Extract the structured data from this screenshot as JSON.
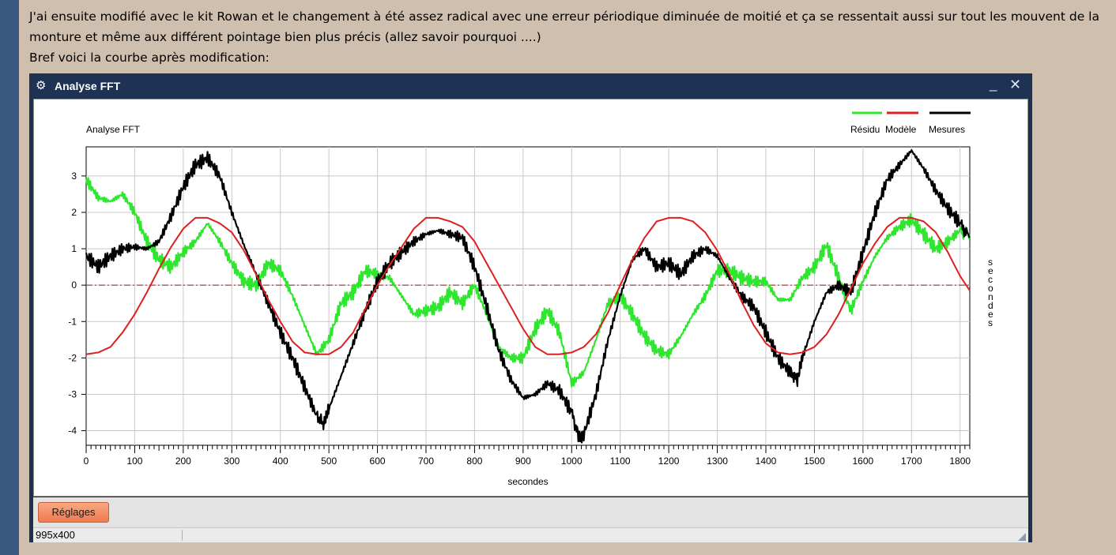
{
  "post": {
    "line1": "J'ai ensuite modifié avec le kit Rowan et le changement à été assez radical avec une erreur périodique diminuée de moitié et ça se ressentait aussi sur tout les mouvent de la",
    "line2": "monture et même aux différent pointage bien plus précis (allez savoir pourquoi ....)",
    "line3": "Bref voici la courbe après modification:"
  },
  "window": {
    "title": "Analyse FFT",
    "icon": "gear-icon",
    "minimize": "_",
    "close": "✕",
    "reglages_label": "Réglages",
    "status_text": "995x400",
    "colors": {
      "titlebar": "#1e3254",
      "button": "#f07a4e"
    }
  },
  "chart_data": {
    "type": "line",
    "title": "Analyse FFT",
    "xlabel": "secondes",
    "ylabel": "secondes",
    "xlim": [
      0,
      1820
    ],
    "ylim": [
      -4.4,
      3.8
    ],
    "xticks": [
      0,
      100,
      200,
      300,
      400,
      500,
      600,
      700,
      800,
      900,
      1000,
      1100,
      1200,
      1300,
      1400,
      1500,
      1600,
      1700,
      1800
    ],
    "yticks": [
      -4,
      -3,
      -2,
      -1,
      0,
      1,
      2,
      3
    ],
    "grid": true,
    "legend_position": "top-right",
    "series": [
      {
        "name": "Modèle",
        "color": "#dd1f1f",
        "x": [
          0,
          25,
          50,
          75,
          100,
          125,
          150,
          175,
          200,
          225,
          250,
          275,
          300,
          325,
          350,
          375,
          400,
          425,
          450,
          475,
          500,
          525,
          550,
          575,
          600,
          625,
          650,
          675,
          700,
          725,
          750,
          775,
          800,
          825,
          850,
          875,
          900,
          925,
          950,
          975,
          1000,
          1025,
          1050,
          1075,
          1100,
          1125,
          1150,
          1175,
          1200,
          1225,
          1250,
          1275,
          1300,
          1325,
          1350,
          1375,
          1400,
          1425,
          1450,
          1475,
          1500,
          1525,
          1550,
          1575,
          1600,
          1625,
          1650,
          1675,
          1700,
          1725,
          1750,
          1775,
          1800,
          1820
        ],
        "y": [
          -1.9,
          -1.85,
          -1.7,
          -1.3,
          -0.8,
          -0.2,
          0.45,
          1.05,
          1.55,
          1.85,
          1.85,
          1.7,
          1.45,
          0.95,
          0.3,
          -0.4,
          -1.0,
          -1.55,
          -1.85,
          -1.9,
          -1.9,
          -1.7,
          -1.3,
          -0.65,
          0.0,
          0.55,
          1.05,
          1.55,
          1.85,
          1.85,
          1.75,
          1.6,
          1.2,
          0.6,
          0.0,
          -0.6,
          -1.2,
          -1.7,
          -1.9,
          -1.9,
          -1.85,
          -1.7,
          -1.35,
          -0.75,
          0.0,
          0.7,
          1.3,
          1.75,
          1.85,
          1.85,
          1.75,
          1.45,
          0.95,
          0.3,
          -0.45,
          -1.1,
          -1.6,
          -1.85,
          -1.9,
          -1.85,
          -1.7,
          -1.35,
          -0.8,
          -0.1,
          0.6,
          1.15,
          1.6,
          1.85,
          1.85,
          1.75,
          1.45,
          0.9,
          0.25,
          -0.15
        ]
      },
      {
        "name": "Mesures",
        "color": "#000000",
        "x": [
          0,
          25,
          50,
          75,
          100,
          125,
          150,
          175,
          200,
          225,
          250,
          275,
          300,
          325,
          350,
          375,
          400,
          425,
          450,
          475,
          490,
          500,
          525,
          550,
          575,
          600,
          625,
          650,
          675,
          700,
          725,
          750,
          775,
          800,
          825,
          850,
          875,
          900,
          925,
          950,
          975,
          1000,
          1015,
          1025,
          1050,
          1075,
          1100,
          1125,
          1150,
          1175,
          1200,
          1225,
          1250,
          1275,
          1300,
          1325,
          1350,
          1375,
          1400,
          1425,
          1450,
          1465,
          1475,
          1500,
          1525,
          1550,
          1575,
          1600,
          1625,
          1650,
          1675,
          1700,
          1725,
          1750,
          1775,
          1800,
          1820
        ],
        "y": [
          0.8,
          0.5,
          0.8,
          1.0,
          1.05,
          1.0,
          1.2,
          1.9,
          2.7,
          3.3,
          3.5,
          3.0,
          2.0,
          1.1,
          0.3,
          -0.5,
          -1.3,
          -2.0,
          -2.8,
          -3.6,
          -3.8,
          -3.4,
          -2.5,
          -1.6,
          -0.7,
          0.1,
          0.6,
          0.9,
          1.2,
          1.4,
          1.5,
          1.4,
          1.3,
          0.5,
          -0.6,
          -1.8,
          -2.6,
          -3.1,
          -3.0,
          -2.7,
          -2.9,
          -3.5,
          -4.2,
          -4.1,
          -3.0,
          -1.5,
          -0.3,
          0.7,
          1.0,
          0.5,
          0.6,
          0.3,
          0.8,
          1.0,
          0.8,
          0.2,
          -0.3,
          -0.6,
          -1.3,
          -2.0,
          -2.4,
          -2.6,
          -2.0,
          -1.0,
          -0.2,
          0.0,
          -0.2,
          0.9,
          2.0,
          2.9,
          3.3,
          3.7,
          3.2,
          2.6,
          2.1,
          1.7,
          1.3
        ]
      },
      {
        "name": "Résidu",
        "color": "#2ee62e",
        "x": [
          0,
          25,
          50,
          75,
          100,
          125,
          150,
          175,
          200,
          225,
          250,
          275,
          300,
          325,
          350,
          375,
          400,
          425,
          450,
          475,
          500,
          525,
          550,
          575,
          600,
          625,
          650,
          675,
          700,
          725,
          750,
          775,
          800,
          825,
          850,
          875,
          900,
          925,
          950,
          975,
          1000,
          1025,
          1050,
          1075,
          1100,
          1125,
          1150,
          1175,
          1200,
          1225,
          1250,
          1275,
          1300,
          1325,
          1350,
          1375,
          1400,
          1425,
          1450,
          1475,
          1500,
          1525,
          1550,
          1575,
          1600,
          1625,
          1650,
          1675,
          1700,
          1725,
          1750,
          1775,
          1800,
          1820
        ],
        "y": [
          2.9,
          2.4,
          2.3,
          2.5,
          2.0,
          1.2,
          0.7,
          0.5,
          0.9,
          1.2,
          1.7,
          1.2,
          0.6,
          0.1,
          0.0,
          0.6,
          0.4,
          -0.3,
          -1.1,
          -1.9,
          -1.5,
          -0.5,
          -0.2,
          0.4,
          0.3,
          0.2,
          -0.3,
          -0.8,
          -0.7,
          -0.6,
          -0.2,
          -0.5,
          0.0,
          -0.8,
          -1.7,
          -2.0,
          -2.0,
          -1.2,
          -0.7,
          -1.3,
          -2.7,
          -2.4,
          -1.5,
          -0.5,
          -0.3,
          -0.8,
          -1.4,
          -1.8,
          -1.9,
          -1.4,
          -0.8,
          -0.3,
          0.4,
          0.4,
          0.2,
          0.1,
          0.1,
          -0.4,
          -0.4,
          0.2,
          0.5,
          1.1,
          0.2,
          -0.7,
          0.1,
          0.8,
          1.3,
          1.6,
          1.8,
          1.4,
          1.0,
          1.2,
          1.5,
          1.4
        ]
      }
    ],
    "zero_line": 0
  }
}
